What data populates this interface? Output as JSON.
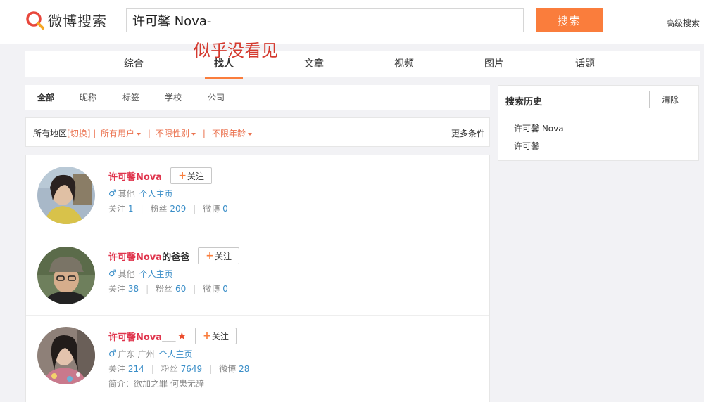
{
  "header": {
    "logo_text": "微博搜索",
    "search_value": "许可馨 Nova-",
    "search_button": "搜索",
    "advanced_link": "高级搜索"
  },
  "overlay_note": "似乎没看见",
  "tabs": [
    {
      "label": "综合"
    },
    {
      "label": "找人",
      "active": true
    },
    {
      "label": "文章"
    },
    {
      "label": "视频"
    },
    {
      "label": "图片"
    },
    {
      "label": "话题"
    }
  ],
  "subtabs": [
    {
      "label": "全部",
      "active": true
    },
    {
      "label": "昵称"
    },
    {
      "label": "标签"
    },
    {
      "label": "学校"
    },
    {
      "label": "公司"
    }
  ],
  "filters": {
    "region_label": "所有地区",
    "switch_link": "[切换]",
    "users": "所有用户",
    "gender": "不限性别",
    "age": "不限年龄",
    "more": "更多条件"
  },
  "results": [
    {
      "name_highlight": "许可馨Nova",
      "name_suffix": "",
      "has_badge": false,
      "follow_label": "关注",
      "location": "其他",
      "homepage": "个人主页",
      "following_label": "关注",
      "following": "1",
      "fans_label": "粉丝",
      "fans": "209",
      "weibo_label": "微博",
      "weibo": "0",
      "intro": ""
    },
    {
      "name_highlight": "许可馨Nova",
      "name_suffix": "的爸爸",
      "has_badge": false,
      "follow_label": "关注",
      "location": "其他",
      "homepage": "个人主页",
      "following_label": "关注",
      "following": "38",
      "fans_label": "粉丝",
      "fans": "60",
      "weibo_label": "微博",
      "weibo": "0",
      "intro": ""
    },
    {
      "name_highlight": "许可馨Nova",
      "name_suffix": "___",
      "has_badge": true,
      "follow_label": "关注",
      "location": "广东 广州",
      "homepage": "个人主页",
      "following_label": "关注",
      "following": "214",
      "fans_label": "粉丝",
      "fans": "7649",
      "weibo_label": "微博",
      "weibo": "28",
      "intro": "简介：欲加之罪 何患无辞"
    }
  ],
  "history": {
    "title": "搜索历史",
    "clear_button": "清除",
    "items": [
      "许可馨 Nova-",
      "许可馨"
    ]
  },
  "colors": {
    "accent": "#fa7d3c",
    "name_highlight": "#e0354d",
    "link": "#3a8ec8",
    "overlay": "#d43a2f"
  }
}
